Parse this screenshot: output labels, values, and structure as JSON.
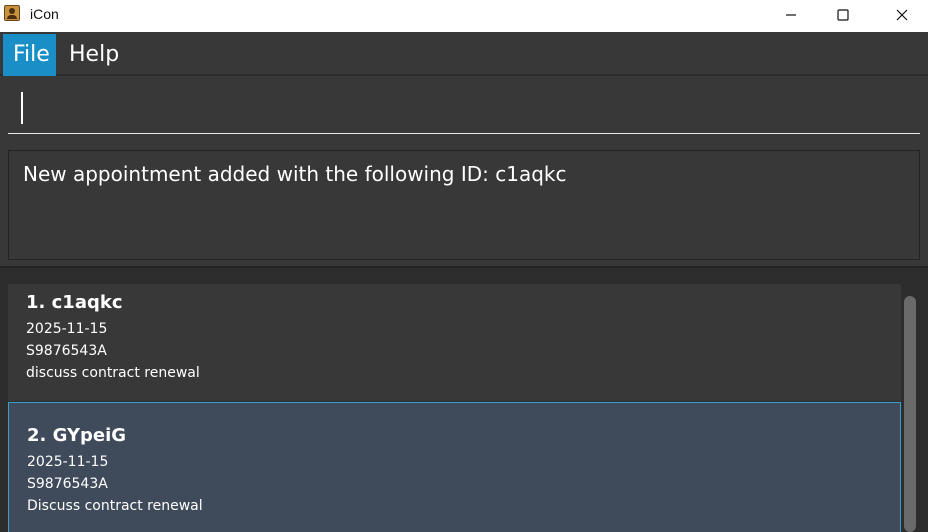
{
  "window": {
    "title": "iCon"
  },
  "menu": {
    "file": "File",
    "help": "Help"
  },
  "command": {
    "value": ""
  },
  "result": {
    "message": "New appointment added with the following ID: c1aqkc"
  },
  "appointments": [
    {
      "title": "1. c1aqkc",
      "date": "2025-11-15",
      "nric": "S9876543A",
      "description": "discuss contract renewal",
      "selected": false
    },
    {
      "title": "2. GYpeiG",
      "date": "2025-11-15",
      "nric": "S9876543A",
      "description": "Discuss contract renewal",
      "selected": true
    }
  ]
}
